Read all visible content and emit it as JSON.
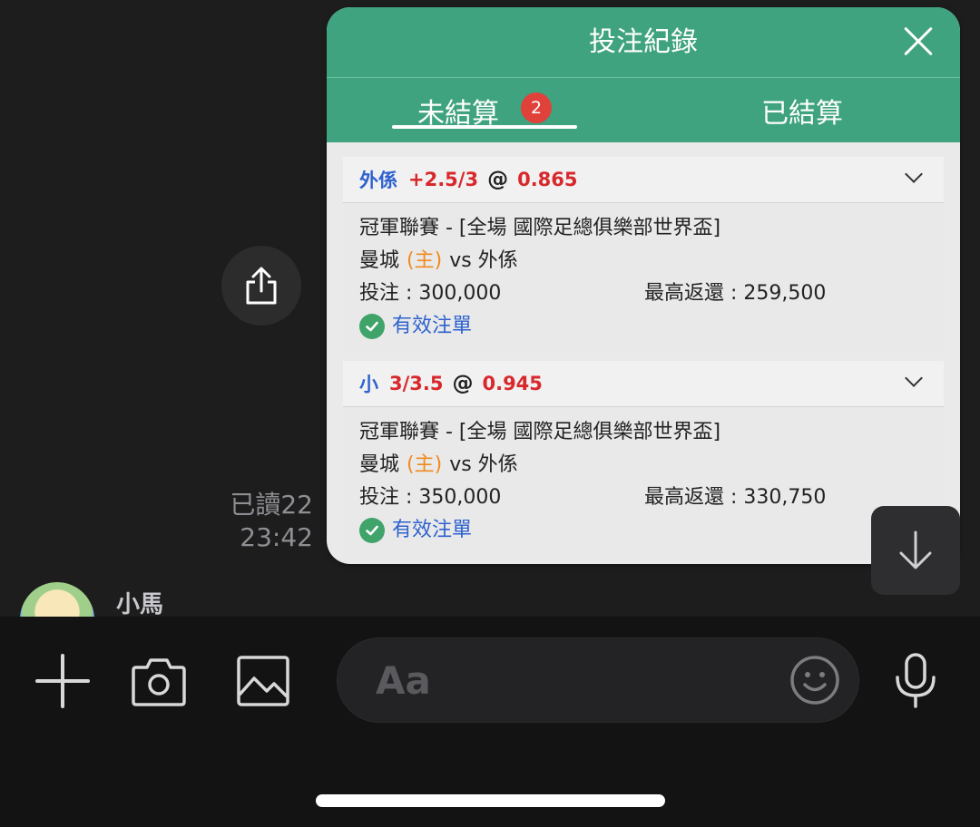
{
  "bet_panel": {
    "title": "投注紀錄",
    "tabs": [
      {
        "label": "未結算",
        "badge": "2",
        "active": true
      },
      {
        "label": "已結算",
        "active": false
      }
    ],
    "bets": [
      {
        "selection": "外係",
        "handicap": "+2.5/3",
        "at": "@",
        "odds": "0.865",
        "league_line": "冠軍聯賽 - [全場 國際足總俱樂部世界盃]",
        "home_team": "曼城",
        "home_tag": "(主)",
        "vs_away": "vs 外係",
        "stake": "投注 : 300,000",
        "max_return": "最高返還 : 259,500",
        "status": "有效注單"
      },
      {
        "selection": "小",
        "handicap": "3/3.5",
        "at": "@",
        "odds": "0.945",
        "league_line": "冠軍聯賽 - [全場 國際足總俱樂部世界盃]",
        "home_team": "曼城",
        "home_tag": "(主)",
        "vs_away": "vs 外係",
        "stake": "投注 : 350,000",
        "max_return": "最高返還 : 330,750",
        "status": "有效注單"
      }
    ]
  },
  "chat": {
    "read_receipt": "已讀22",
    "time": "23:42",
    "sender_name": "小馬"
  },
  "composer": {
    "placeholder": "Aa"
  },
  "icons": {
    "share": "share-icon",
    "scroll_down": "arrow-down-icon",
    "add": "plus-icon",
    "camera": "camera-icon",
    "gallery": "image-icon",
    "emoji": "smiley-icon",
    "mic": "microphone-icon",
    "close": "close-icon",
    "expand": "chevron-down-icon",
    "valid": "check-circle-icon"
  },
  "colors": {
    "header_green": "#3fa37f",
    "badge_red": "#e0413b",
    "selection_blue": "#2e62cf",
    "odds_red": "#d8282c",
    "home_orange": "#f08a1e",
    "chat_bg": "#1d1d1e"
  }
}
